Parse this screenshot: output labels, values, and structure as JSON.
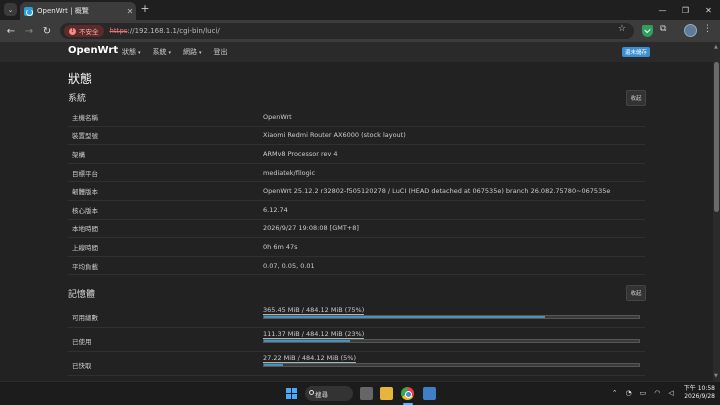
{
  "browser": {
    "tab_title": "OpenWrt | 概覽",
    "tab_close": "✕",
    "new_tab": "+",
    "url_scheme": "https",
    "url_rest": "://192.168.1.1/cgi-bin/luci/",
    "insecure_label": "不安全",
    "colors": {
      "accent": "#3b8ed0",
      "insecure": "#f28b82"
    }
  },
  "luci": {
    "brand": "OpenWrt",
    "menu": [
      {
        "label": "狀態",
        "caret": "▾"
      },
      {
        "label": "系統",
        "caret": "▾"
      },
      {
        "label": "網路",
        "caret": "▾"
      },
      {
        "label": "登出",
        "caret": ""
      }
    ],
    "unsaved_badge": "還未儲存",
    "page_title": "狀態",
    "system": {
      "title": "系統",
      "collapse_label": "收起",
      "rows": [
        {
          "label": "主機名稱",
          "value": "OpenWrt"
        },
        {
          "label": "裝置型號",
          "value": "Xiaomi Redmi Router AX6000 (stock layout)"
        },
        {
          "label": "架構",
          "value": "ARMv8 Processor rev 4"
        },
        {
          "label": "目標平台",
          "value": "mediatek/filogic"
        },
        {
          "label": "韌體版本",
          "value": "OpenWrt 25.12.2 r32802-f505120278 / LuCI (HEAD detached at 067535e) branch 26.082.75780~067535e"
        },
        {
          "label": "核心版本",
          "value": "6.12.74"
        },
        {
          "label": "本地時間",
          "value": "2026/9/27 19:08:08 [GMT+8]"
        },
        {
          "label": "上線時間",
          "value": "0h 6m 47s"
        },
        {
          "label": "平均負載",
          "value": "0.07, 0.05, 0.01"
        }
      ]
    },
    "memory": {
      "title": "記憶體",
      "collapse_label": "收起",
      "rows": [
        {
          "label": "可用總數",
          "text": "365.45 MiB / 484.12 MiB (75%)",
          "percent": 75
        },
        {
          "label": "已使用",
          "text": "111.37 MiB / 484.12 MiB (23%)",
          "percent": 23
        },
        {
          "label": "已快取",
          "text": "27.22 MiB / 484.12 MiB (5%)",
          "percent": 5
        }
      ]
    }
  },
  "taskbar": {
    "search_label": "搜尋",
    "time": "下午 10:58",
    "date": "2026/9/28"
  }
}
